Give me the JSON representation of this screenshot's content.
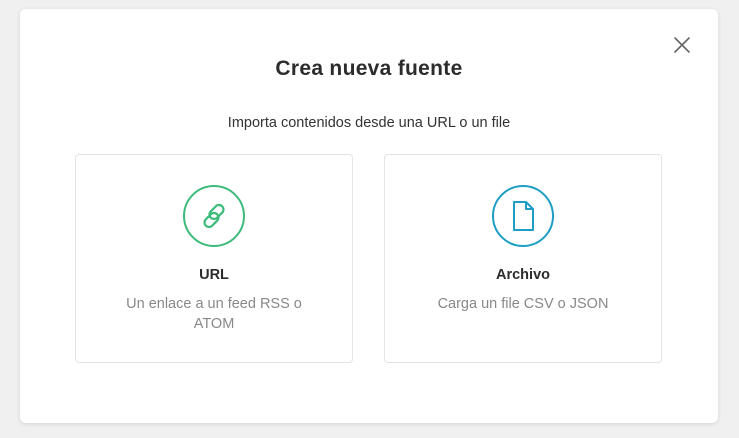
{
  "modal": {
    "title": "Crea nueva fuente",
    "subtitle": "Importa contenidos desde una URL o un file",
    "close_icon": "close-icon"
  },
  "options": [
    {
      "id": "url",
      "icon": "link-icon",
      "icon_color": "#3dbb7a",
      "title": "URL",
      "description": "Un enlace a un feed RSS o ATOM"
    },
    {
      "id": "file",
      "icon": "file-icon",
      "icon_color": "#1e9ec4",
      "title": "Archivo",
      "description": "Carga un file CSV o JSON"
    }
  ]
}
